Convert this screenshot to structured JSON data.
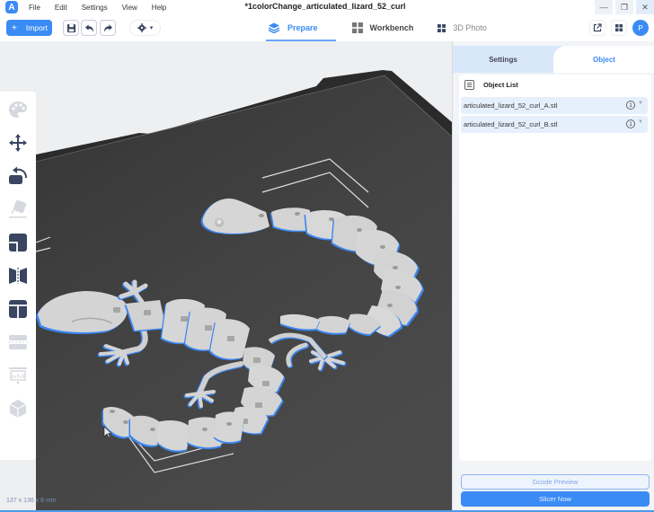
{
  "app": {
    "logo_letter": "A",
    "window_title": "*1colorChange_articulated_lizard_52_curl",
    "menu": [
      "File",
      "Edit",
      "Settings",
      "View",
      "Help"
    ],
    "window_controls": {
      "minimize": "—",
      "restore": "❐",
      "close": "✕"
    }
  },
  "toolbar": {
    "import_label": "Import",
    "import_icon": "+",
    "save_icon": "save-icon",
    "undo_icon": "undo-icon",
    "redo_icon": "redo-icon",
    "view_selector_icon": "camera-view-icon",
    "view_selector_caret": "▾"
  },
  "main_tabs": [
    {
      "label": "Prepare",
      "icon": "layers-icon",
      "active": true
    },
    {
      "label": "Workbench",
      "icon": "workbench-icon",
      "active": false
    },
    {
      "label": "3D Photo",
      "icon": "grid-icon",
      "active": false,
      "dimmed": true
    }
  ],
  "right_tools": {
    "share_icon": "external-link-icon",
    "apps_icon": "apps-icon",
    "avatar_letter": "P"
  },
  "left_tools": [
    {
      "name": "color-palette",
      "enabled": false
    },
    {
      "name": "move",
      "enabled": true
    },
    {
      "name": "rotate",
      "enabled": true
    },
    {
      "name": "lay-on-face",
      "enabled": false
    },
    {
      "name": "scale",
      "enabled": true
    },
    {
      "name": "mirror",
      "enabled": true
    },
    {
      "name": "split",
      "enabled": true
    },
    {
      "name": "cut",
      "enabled": false
    },
    {
      "name": "support",
      "enabled": false
    },
    {
      "name": "arrange",
      "enabled": false
    }
  ],
  "viewport": {
    "model_dimensions": "137 x 136 x 6 mm",
    "plate_color": "#3b3b3b",
    "model_color": "#d4d4d4",
    "outline_color": "#3a85f0"
  },
  "panel": {
    "tabs": [
      {
        "label": "Settings",
        "active": false
      },
      {
        "label": "Object",
        "active": true
      }
    ],
    "object_list_title": "Object List",
    "objects": [
      {
        "name": "articulated_lizard_52_curl_A.stl",
        "count": "1"
      },
      {
        "name": "articulated_lizard_52_curl_B.stl",
        "count": "1"
      }
    ],
    "gcode_preview_label": "Gcode Preview",
    "slice_label": "Slicer Now"
  },
  "colors": {
    "accent": "#3b8bf5",
    "panel_tab_bg": "#d9e7fb",
    "row_bg": "#e6effc"
  }
}
